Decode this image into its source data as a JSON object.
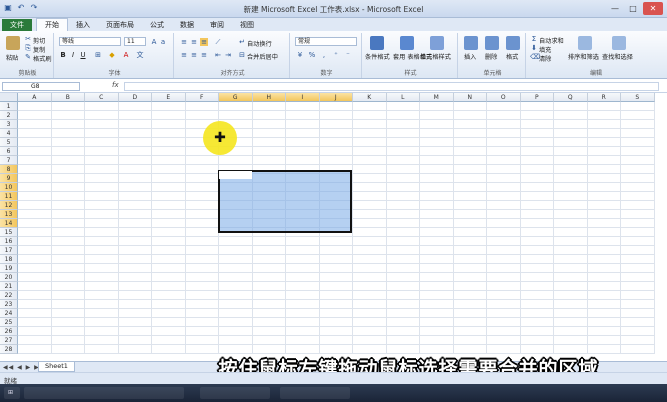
{
  "window": {
    "title": "新建 Microsoft Excel 工作表.xlsx - Microsoft Excel"
  },
  "quick_access": [
    "save-icon",
    "undo-icon",
    "redo-icon"
  ],
  "tabs": [
    "文件",
    "开始",
    "插入",
    "页面布局",
    "公式",
    "数据",
    "审阅",
    "视图"
  ],
  "ribbon": {
    "clipboard": {
      "paste": "粘贴",
      "cut": "剪切",
      "copy": "复制",
      "format_painter": "格式刷",
      "label": "剪贴板"
    },
    "font": {
      "font_name": "等线",
      "font_size": "11",
      "label": "字体"
    },
    "alignment": {
      "wrap": "自动换行",
      "merge": "合并后居中",
      "label": "对齐方式"
    },
    "number": {
      "format": "常规",
      "label": "数字"
    },
    "styles": {
      "conditional": "条件格式",
      "table": "套用\n表格格式",
      "cell_styles": "单元格样式",
      "label": "样式"
    },
    "cells": {
      "insert": "插入",
      "delete": "删除",
      "format": "格式",
      "label": "单元格"
    },
    "editing": {
      "autosum": "自动求和",
      "fill": "填充",
      "clear": "清除",
      "sort": "排序和筛选",
      "find": "查找和选择",
      "label": "编辑"
    }
  },
  "formula_bar": {
    "name_box": "G8",
    "fx": "fx",
    "value": ""
  },
  "grid": {
    "columns": [
      "A",
      "B",
      "C",
      "D",
      "E",
      "F",
      "G",
      "H",
      "I",
      "J",
      "K",
      "L",
      "M",
      "N",
      "O",
      "P",
      "Q",
      "R",
      "S"
    ],
    "rows": [
      "1",
      "2",
      "3",
      "4",
      "5",
      "6",
      "7",
      "8",
      "9",
      "10",
      "11",
      "12",
      "13",
      "14",
      "15",
      "16",
      "17",
      "18",
      "19",
      "20",
      "21",
      "22",
      "23",
      "24",
      "25",
      "26",
      "27",
      "28"
    ],
    "selection": "G8:J14"
  },
  "sheet_tabs": [
    "Sheet1"
  ],
  "status": "就绪",
  "subtitle": "按住鼠标左键拖动鼠标选择需要合并的区域",
  "colors": {
    "accent": "#2a7a3a",
    "selection": "#78aae6",
    "cursor": "#f5e61e"
  }
}
